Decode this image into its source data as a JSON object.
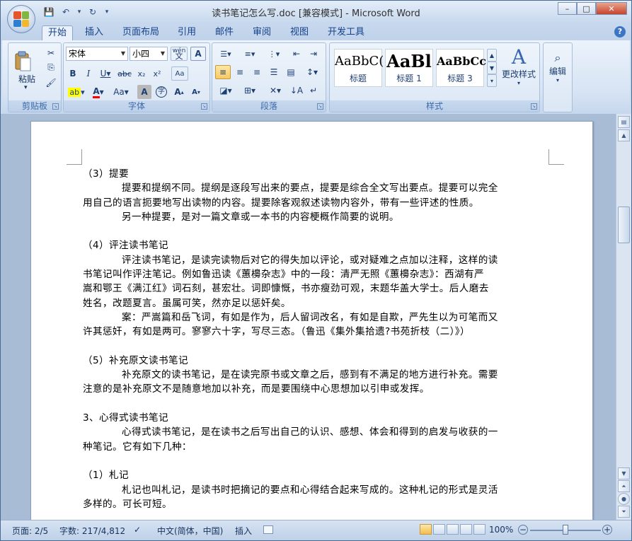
{
  "window": {
    "title": "读书笔记怎么写.doc [兼容模式] - Microsoft Word",
    "controls": {
      "minimize": "–",
      "maximize": "□",
      "close": "✕"
    }
  },
  "qat": {
    "save": "💾",
    "undo": "↶",
    "redo": "↻",
    "more": "▾"
  },
  "tabs": [
    "开始",
    "插入",
    "页面布局",
    "引用",
    "邮件",
    "审阅",
    "视图",
    "开发工具"
  ],
  "active_tab": "开始",
  "help": "?",
  "ribbon": {
    "clipboard": {
      "name": "剪贴板",
      "paste": "粘贴"
    },
    "font": {
      "name": "字体",
      "font_family": "宋体",
      "font_size": "小四",
      "wen": "wén",
      "A_box": "A",
      "A_circle": "字"
    },
    "paragraph": {
      "name": "段落"
    },
    "styles": {
      "name": "样式",
      "items": [
        {
          "preview": "AaBbC(",
          "label": "标题"
        },
        {
          "preview": "AaBl",
          "label": "标题 1"
        },
        {
          "preview": "AaBbCc",
          "label": "标题 3"
        }
      ],
      "change": "更改样式"
    },
    "editing": {
      "name": "编辑"
    }
  },
  "document": {
    "lines": [
      {
        "t": "（3）提要",
        "indent": false
      },
      {
        "t": "提要和提纲不同。提纲是逐段写出来的要点，提要是综合全文写出要点。提要可以完全",
        "indent": true
      },
      {
        "t": "用自己的语言扼要地写出读物的内容。提要除客观叙述读物内容外，带有一些评述的性质。",
        "indent": false
      },
      {
        "t": "另一种提要，是对一篇文章或一本书的内容梗概作简要的说明。",
        "indent": true
      },
      {
        "t": "",
        "indent": false
      },
      {
        "t": "（4）评注读书笔记",
        "indent": false
      },
      {
        "t": "评注读书笔记，是读完读物后对它的得失加以评论，或对疑难之点加以注释，这样的读",
        "indent": true
      },
      {
        "t": "书笔记叫作评注笔记。例如鲁迅读《蕙櫋杂志》中的一段：清严无照《蕙櫋杂志》：西湖有严",
        "indent": false
      },
      {
        "t": "嵩和鄂王《满江红》词石刻，甚宏壮。词即慷慨，书亦瘦劲可观，末题华盖大学士。后人磨去",
        "indent": false
      },
      {
        "t": "姓名，改题夏言。虽属可笑，然亦足以惩奸矣。",
        "indent": false
      },
      {
        "t": "案：严嵩篇和岳飞词，有如是作为，后人留词改名，有如是自欺，严先生以为可笔而又",
        "indent": true
      },
      {
        "t": "许其惩奸，有如是两可。寥寥六十字，写尽三态。（鲁迅《集外集拾遗?书苑折枝（二）》）",
        "indent": false
      },
      {
        "t": "",
        "indent": false
      },
      {
        "t": "（5）补充原文读书笔记",
        "indent": false
      },
      {
        "t": "补充原文的读书笔记，是在读完原书或文章之后，感到有不满足的地方进行补充。需要",
        "indent": true
      },
      {
        "t": "注意的是补充原文不是随意地加以补充，而是要围绕中心思想加以引申或发挥。",
        "indent": false
      },
      {
        "t": "",
        "indent": false
      },
      {
        "t": "3、心得式读书笔记",
        "indent": false
      },
      {
        "t": "心得式读书笔记，是在读书之后写出自己的认识、感想、体会和得到的启发与收获的一",
        "indent": true
      },
      {
        "t": "种笔记。它有如下几种：",
        "indent": false
      },
      {
        "t": "",
        "indent": false
      },
      {
        "t": "（1）札记",
        "indent": false
      },
      {
        "t": "札记也叫札记，是读书时把摘记的要点和心得结合起来写成的。这种札记的形式是灵活",
        "indent": true
      },
      {
        "t": "多样的。可长可短。",
        "indent": false
      }
    ]
  },
  "status": {
    "page": "页面: 2/5",
    "words": "字数: 217/4,812",
    "language": "中文(简体，中国)",
    "mode": "插入",
    "zoom": "100%",
    "zoom_minus": "−",
    "zoom_plus": "+"
  },
  "colors": {
    "highlight": "#ffff00",
    "font_color": "#ff0000",
    "accent": "#15428b"
  }
}
